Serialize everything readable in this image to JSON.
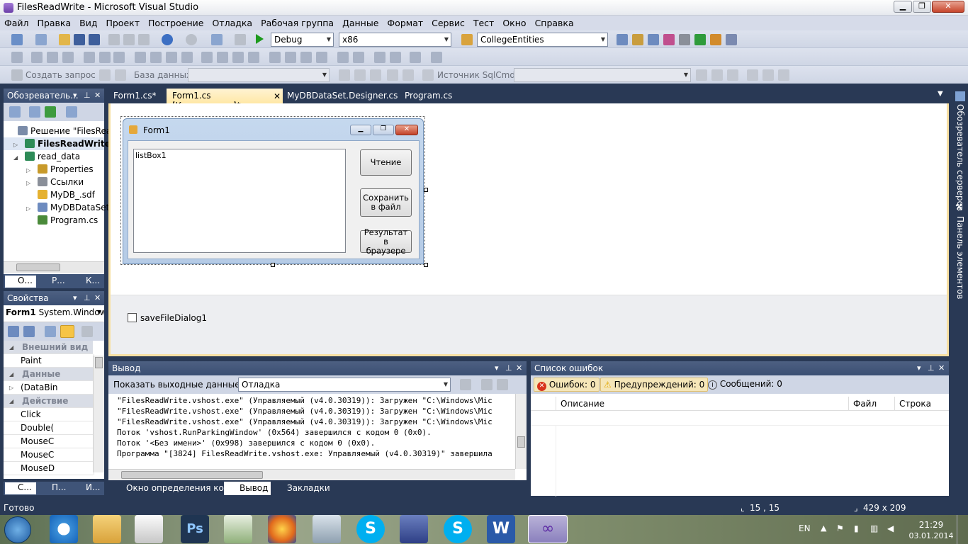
{
  "window": {
    "title": "FilesReadWrite - Microsoft Visual Studio",
    "min": "▁",
    "max": "❐",
    "close": "✕"
  },
  "menu": [
    "Файл",
    "Правка",
    "Вид",
    "Проект",
    "Построение",
    "Отладка",
    "Рабочая группа",
    "Данные",
    "Формат",
    "Сервис",
    "Тест",
    "Окно",
    "Справка"
  ],
  "toolbar1": {
    "config": "Debug",
    "platform": "x86",
    "connection": "CollegeEntities"
  },
  "toolbar3": {
    "create_query": "Создать запрос",
    "database_label": "База данных:",
    "sqlcmd_label": "Источник SqlCmd:"
  },
  "solution_explorer": {
    "title": "Обозреватель...",
    "items": [
      {
        "label": "Решение \"FilesRead",
        "bold": false
      },
      {
        "label": "FilesReadWrite",
        "bold": true
      },
      {
        "label": "read_data",
        "bold": false
      },
      {
        "label": "Properties",
        "bold": false
      },
      {
        "label": "Ссылки",
        "bold": false
      },
      {
        "label": "MyDB_.sdf",
        "bold": false
      },
      {
        "label": "MyDBDataSet",
        "bold": false
      },
      {
        "label": "Program.cs",
        "bold": false
      }
    ],
    "tabs": [
      "О...",
      "Р...",
      "К..."
    ]
  },
  "properties": {
    "title": "Свойства",
    "object_name": "Form1",
    "object_type": "System.Window",
    "rows": [
      {
        "label": "Внешний вид",
        "cat": true
      },
      {
        "label": "Paint",
        "cat": false
      },
      {
        "label": "Данные",
        "cat": true
      },
      {
        "label": "(DataBin",
        "cat": false
      },
      {
        "label": "Действие",
        "cat": true
      },
      {
        "label": "Click",
        "cat": false
      },
      {
        "label": "Double(",
        "cat": false
      },
      {
        "label": "MouseC",
        "cat": false
      },
      {
        "label": "MouseC",
        "cat": false
      },
      {
        "label": "MouseD",
        "cat": false
      }
    ]
  },
  "doc_tabs": [
    "Form1.cs*",
    "Form1.cs [Конструктор]*",
    "MyDBDataSet.Designer.cs",
    "Program.cs"
  ],
  "form": {
    "title": "Form1",
    "listbox": "listBox1",
    "btn_read": "Чтение",
    "btn_save": "Сохранить в файл",
    "btn_result": "Результат в браузере",
    "component": "saveFileDialog1"
  },
  "right_sidebar": {
    "server_explorer": "Обозреватель серверов",
    "toolbox": "Панель элементов"
  },
  "output": {
    "title": "Вывод",
    "show_label": "Показать выходные данные от:",
    "source": "Отладка",
    "lines": [
      "\"FilesReadWrite.vshost.exe\" (Управляемый (v4.0.30319)): Загружен \"C:\\Windows\\Mic",
      "\"FilesReadWrite.vshost.exe\" (Управляемый (v4.0.30319)): Загружен \"C:\\Windows\\Mic",
      "\"FilesReadWrite.vshost.exe\" (Управляемый (v4.0.30319)): Загружен \"C:\\Windows\\Mic",
      "Поток 'vshost.RunParkingWindow' (0x564) завершился с кодом 0 (0x0).",
      "Поток '<Без имени>' (0x998) завершился с кодом 0 (0x0).",
      "Программа \"[3824] FilesReadWrite.vshost.exe: Управляемый (v4.0.30319)\" завершила"
    ]
  },
  "errors": {
    "title": "Список ошибок",
    "errors": "Ошибок: 0",
    "warnings": "Предупреждений: 0",
    "messages": "Сообщений: 0",
    "columns": [
      "Описание",
      "Файл",
      "Строка"
    ]
  },
  "bottom_tabs": {
    "left": [
      "С...",
      "П...",
      "И..."
    ],
    "mid": [
      "Окно определения кода",
      "Вывод",
      "Закладки"
    ]
  },
  "status": {
    "text": "Готово",
    "pos": "15 , 15",
    "size": "429 x 209"
  },
  "taskbar": {
    "lang": "EN",
    "time": "21:29",
    "date": "03.01.2014"
  }
}
